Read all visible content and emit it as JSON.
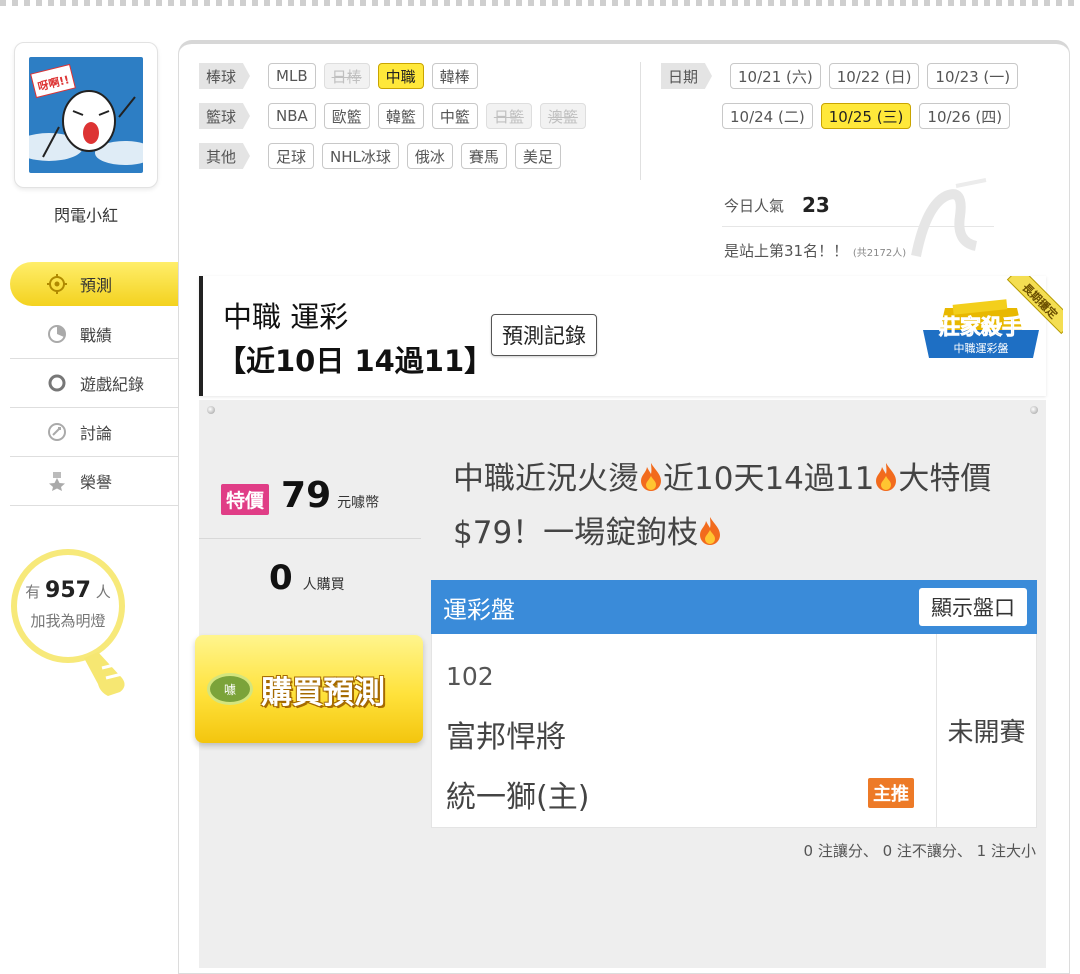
{
  "user": {
    "name": "閃電小紅",
    "avatar_text": "呀啊!!"
  },
  "sidebar": {
    "items": [
      {
        "label": "預測",
        "icon": "target-icon",
        "active": true
      },
      {
        "label": "戰績",
        "icon": "chart-icon",
        "active": false
      },
      {
        "label": "遊戲紀錄",
        "icon": "circle-icon",
        "active": false
      },
      {
        "label": "討論",
        "icon": "chat-icon",
        "active": false
      },
      {
        "label": "榮譽",
        "icon": "medal-icon",
        "active": false
      }
    ]
  },
  "fans": {
    "prefix": "有",
    "count": "957",
    "suffix": "人",
    "line2": "加我為明燈"
  },
  "filters": {
    "baseball": {
      "label": "棒球",
      "options": [
        {
          "text": "MLB",
          "state": "normal"
        },
        {
          "text": "日棒",
          "state": "disabled"
        },
        {
          "text": "中職",
          "state": "selected"
        },
        {
          "text": "韓棒",
          "state": "normal"
        }
      ]
    },
    "basketball": {
      "label": "籃球",
      "options": [
        {
          "text": "NBA",
          "state": "normal"
        },
        {
          "text": "歐籃",
          "state": "normal"
        },
        {
          "text": "韓籃",
          "state": "normal"
        },
        {
          "text": "中籃",
          "state": "normal"
        },
        {
          "text": "日籃",
          "state": "disabled"
        },
        {
          "text": "澳籃",
          "state": "disabled"
        }
      ]
    },
    "other": {
      "label": "其他",
      "options": [
        {
          "text": "足球",
          "state": "normal"
        },
        {
          "text": "NHL冰球",
          "state": "normal"
        },
        {
          "text": "俄冰",
          "state": "normal"
        },
        {
          "text": "賽馬",
          "state": "normal"
        },
        {
          "text": "美足",
          "state": "normal"
        }
      ]
    },
    "date": {
      "label": "日期",
      "row1": [
        {
          "text": "10/21 (六)",
          "state": "normal"
        },
        {
          "text": "10/22 (日)",
          "state": "normal"
        },
        {
          "text": "10/23 (一)",
          "state": "normal"
        }
      ],
      "row2": [
        {
          "text": "10/24 (二)",
          "state": "normal"
        },
        {
          "text": "10/25 (三)",
          "state": "selected"
        },
        {
          "text": "10/26 (四)",
          "state": "normal"
        }
      ]
    }
  },
  "stats": {
    "popularity_label": "今日人氣",
    "popularity_value": "23",
    "rank_text": "是站上第31名！！",
    "rank_note": "(共2172人)"
  },
  "header": {
    "title": "中職 運彩",
    "subtitle": "【近10日 14過11】",
    "record_button": "預測記錄",
    "badge_main": "莊家殺手",
    "badge_sub": "中職運彩盤",
    "badge_ribbon": "長期穩定"
  },
  "offer": {
    "tag": "特價",
    "price": "79",
    "unit": "元噱幣",
    "buyers_count": "0",
    "buyers_label": "人購買",
    "buy_button": "購買預測",
    "buy_icon_text": "噱"
  },
  "headline": {
    "part1": "中職近況火燙",
    "part2": "近10天14過11",
    "part3": "大特價$79！一場錠鉤枝"
  },
  "odds": {
    "panel_title": "運彩盤",
    "show_button": "顯示盤口",
    "game_no": "102",
    "team_away": "富邦悍將",
    "team_home": "統一獅(主)",
    "pick_badge": "主推",
    "status": "未開賽",
    "summary": "0 注讓分、 0 注不讓分、 1 注大小"
  },
  "colors": {
    "accent_yellow": "#ffe83a",
    "odds_blue": "#3a8bd9",
    "price_pink": "#e03d86",
    "pick_orange": "#ed7a27"
  }
}
